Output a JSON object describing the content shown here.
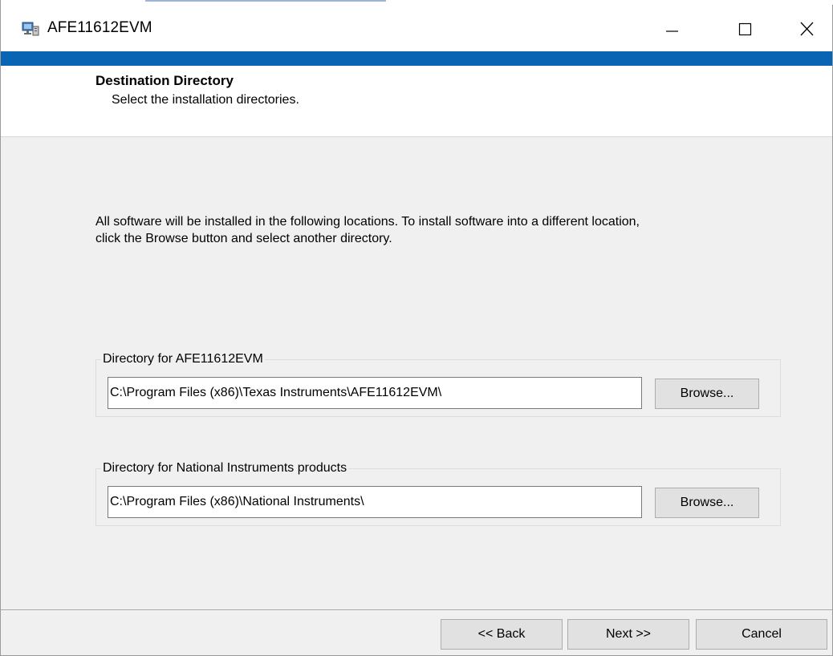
{
  "window": {
    "title": "AFE11612EVM",
    "icons": {
      "app": "installer-monitor-icon",
      "minimize": "minimize-icon",
      "maximize": "maximize-icon",
      "close": "close-icon"
    }
  },
  "header": {
    "title": "Destination Directory",
    "subtitle": "Select the installation directories."
  },
  "body": {
    "description": "All software will be installed in the following locations. To install software into a different location, click the Browse button and select another directory."
  },
  "directories": [
    {
      "label": "Directory for AFE11612EVM",
      "value": "C:\\Program Files (x86)\\Texas Instruments\\AFE11612EVM\\",
      "browse_label": "Browse..."
    },
    {
      "label": "Directory for National Instruments products",
      "value": "C:\\Program Files (x86)\\National Instruments\\",
      "browse_label": "Browse..."
    }
  ],
  "footer": {
    "back_label": "<< Back",
    "next_label": "Next >>",
    "cancel_label": "Cancel"
  },
  "colors": {
    "accent": "#0a64b4",
    "window_background": "#f0f0f0",
    "header_background": "#ffffff",
    "button_face": "#e1e1e1"
  }
}
